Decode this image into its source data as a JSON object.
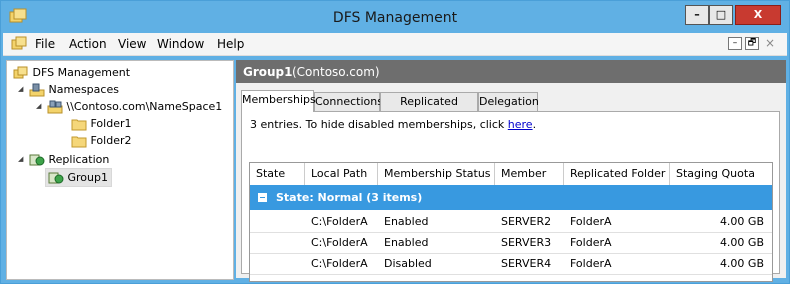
{
  "window": {
    "title": "DFS Management"
  },
  "window_controls": {
    "minimize": "–",
    "maximize": "□",
    "close": "X"
  },
  "menu": {
    "items": [
      "File",
      "Action",
      "View",
      "Window",
      "Help"
    ]
  },
  "mdi_controls": {
    "minimize": "–",
    "restore": "🗗",
    "close": "×"
  },
  "tree": {
    "root": "DFS Management",
    "namespaces": "Namespaces",
    "namespace1": "\\\\Contoso.com\\NameSpace1",
    "folder1": "Folder1",
    "folder2": "Folder2",
    "replication": "Replication",
    "group1": "Group1"
  },
  "details": {
    "header_name": "Group1",
    "header_domain": "(Contoso.com)",
    "tabs": [
      "Memberships",
      "Connections",
      "Replicated Folders",
      "Delegation"
    ],
    "active_tab": "Memberships",
    "info_text": "3 entries. To hide disabled memberships, click",
    "info_link": "here",
    "info_end": ".",
    "columns": [
      "State",
      "Local Path",
      "Membership Status",
      "Member",
      "Replicated Folder",
      "Staging Quota"
    ],
    "group_label": "State: Normal (3 items)",
    "rows": [
      [
        "",
        "C:\\FolderA",
        "Enabled",
        "SERVER2",
        "FolderA",
        "4.00 GB"
      ],
      [
        "",
        "C:\\FolderA",
        "Enabled",
        "SERVER3",
        "FolderA",
        "4.00 GB"
      ],
      [
        "",
        "C:\\FolderA",
        "Disabled",
        "SERVER4",
        "FolderA",
        "4.00 GB"
      ]
    ]
  },
  "colors": {
    "titlebar": "#60b0e4",
    "group_header": "#3899e0",
    "details_header": "#6e6e6e",
    "close_button": "#c83a30"
  },
  "icons": [
    "dfs-app-icon",
    "namespaces-icon",
    "namespace-icon",
    "folder-icon",
    "replication-icon",
    "replication-group-icon"
  ]
}
